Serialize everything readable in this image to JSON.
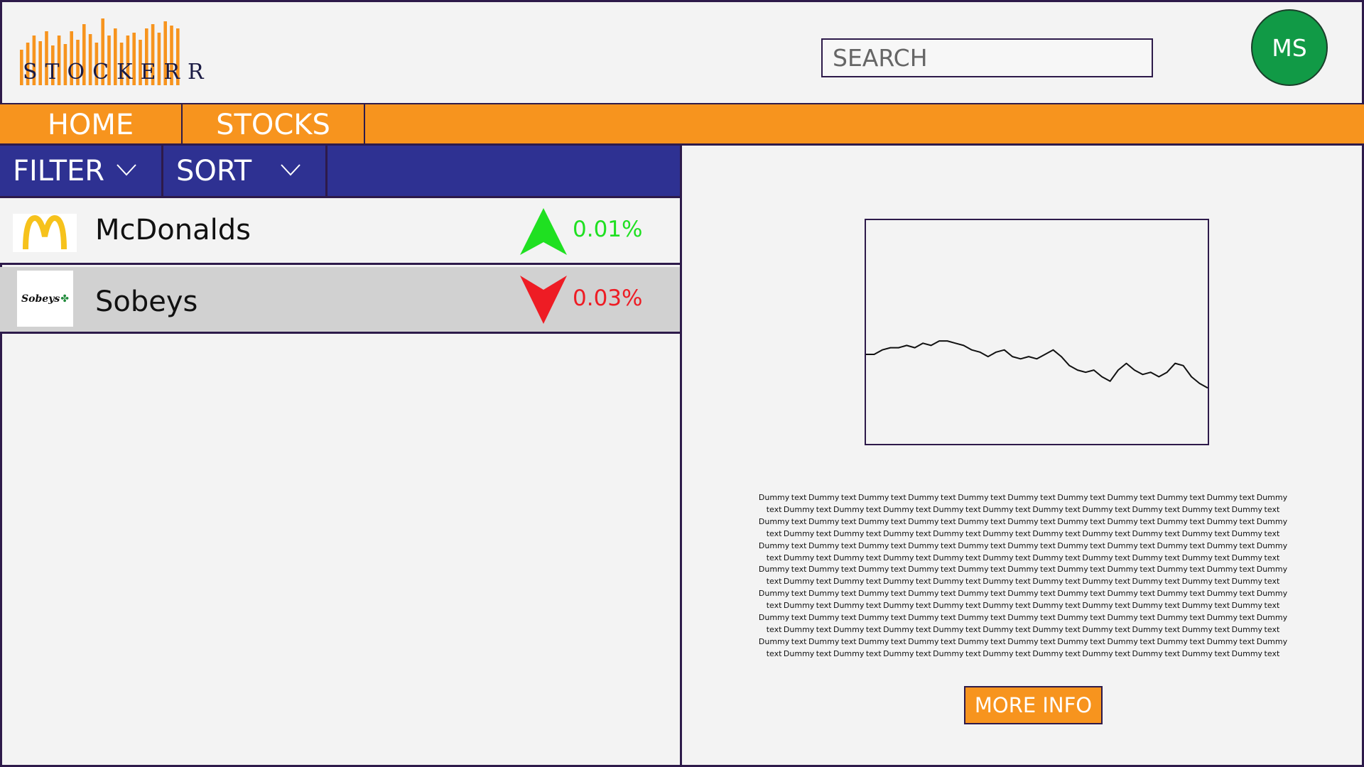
{
  "header": {
    "logo_text": "STOCKERR",
    "search_placeholder": "SEARCH",
    "avatar_initials": "MS"
  },
  "nav": {
    "tabs": [
      {
        "label": "HOME"
      },
      {
        "label": "STOCKS"
      }
    ]
  },
  "toolbar": {
    "filter_label": "FILTER",
    "sort_label": "SORT"
  },
  "stocks": [
    {
      "name": "McDonalds",
      "logo": "mcdonalds-logo",
      "change": "0.01%",
      "direction": "up",
      "color": "#1fe021"
    },
    {
      "name": "Sobeys",
      "logo": "sobeys-logo",
      "logo_text": "Sobeys",
      "change": "0.03%",
      "direction": "down",
      "color": "#ee1c24",
      "selected": true
    }
  ],
  "detail": {
    "description": "Dummy text Dummy text Dummy text Dummy text Dummy text Dummy text Dummy text Dummy text Dummy text Dummy text Dummy text Dummy text Dummy text Dummy text Dummy text Dummy text Dummy text Dummy text Dummy text Dummy text Dummy text Dummy text Dummy text Dummy text Dummy text Dummy text Dummy text Dummy text Dummy text Dummy text Dummy text Dummy text Dummy text Dummy text Dummy text Dummy text Dummy text Dummy text Dummy text Dummy text Dummy text Dummy text Dummy text Dummy text Dummy text Dummy text Dummy text Dummy text Dummy text Dummy text Dummy text Dummy text Dummy text Dummy text Dummy text Dummy text Dummy text Dummy text Dummy text Dummy text Dummy text Dummy text Dummy text Dummy text Dummy text Dummy text Dummy text Dummy text Dummy text Dummy text Dummy text Dummy text Dummy text Dummy text Dummy text Dummy text Dummy text Dummy text Dummy text Dummy text Dummy text Dummy text Dummy text Dummy text Dummy text Dummy text Dummy text Dummy text Dummy text Dummy text Dummy text Dummy text Dummy text Dummy text Dummy text Dummy text Dummy text Dummy text Dummy text Dummy text Dummy text Dummy text Dummy text Dummy text Dummy text Dummy text Dummy text Dummy text Dummy text Dummy text Dummy text Dummy text Dummy text Dummy text Dummy text Dummy text Dummy text Dummy text Dummy text Dummy text Dummy text Dummy text Dummy text Dummy text Dummy text Dummy text Dummy text Dummy text Dummy text Dummy text Dummy text Dummy text Dummy text Dummy text Dummy text Dummy text Dummy text Dummy text Dummy text Dummy text Dummy text Dummy text Dummy text Dummy text Dummy text Dummy text Dummy text",
    "more_info_label": "MORE INFO"
  },
  "colors": {
    "brand_orange": "#f7941e",
    "toolbar_navy": "#2e3192",
    "avatar_green": "#119a46",
    "border_purple": "#2d1a4a"
  },
  "chart_data": {
    "type": "line",
    "series": [
      {
        "values": [
          40,
          40,
          42,
          43,
          43,
          44,
          43,
          45,
          44,
          46,
          46,
          45,
          44,
          42,
          41,
          39,
          41,
          42,
          39,
          38,
          39,
          38,
          40,
          42,
          39,
          35,
          33,
          32,
          33,
          30,
          28,
          33,
          36,
          33,
          31,
          32,
          30,
          32,
          36,
          35,
          30,
          27,
          25
        ]
      }
    ],
    "ylim": [
      0,
      100
    ],
    "grid": false
  }
}
